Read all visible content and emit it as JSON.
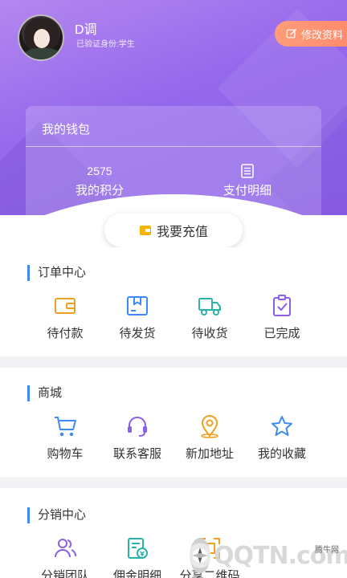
{
  "profile": {
    "name": "D调",
    "verify_text": "已验证身份:学生",
    "edit_label": "修改资料"
  },
  "wallet": {
    "title": "我的钱包",
    "points_value": "2575",
    "points_label": "我的积分",
    "payment_label": "支付明细"
  },
  "recharge_label": "我要充值",
  "orders": {
    "title": "订单中心",
    "items": [
      {
        "label": "待付款",
        "icon": "wallet-icon"
      },
      {
        "label": "待发货",
        "icon": "package-icon"
      },
      {
        "label": "待收货",
        "icon": "truck-icon"
      },
      {
        "label": "已完成",
        "icon": "clipboard-check-icon"
      }
    ]
  },
  "mall": {
    "title": "商城",
    "items": [
      {
        "label": "购物车",
        "icon": "cart-icon"
      },
      {
        "label": "联系客服",
        "icon": "headset-icon"
      },
      {
        "label": "新加地址",
        "icon": "location-icon"
      },
      {
        "label": "我的收藏",
        "icon": "star-icon"
      }
    ]
  },
  "distribution": {
    "title": "分销中心",
    "items": [
      {
        "label": "分销团队",
        "icon": "team-icon"
      },
      {
        "label": "佣金明细",
        "icon": "commission-icon"
      },
      {
        "label": "分享二维码",
        "icon": "qrcode-icon"
      }
    ]
  },
  "watermark": {
    "text": "QQTN.com",
    "small": "腾牛网"
  },
  "colors": {
    "header_gradient_start": "#b487f0",
    "header_gradient_end": "#8a5fe6",
    "section_accent": "#3d8bf2",
    "orange_icon": "#f0a020",
    "blue_icon": "#3d8bf2",
    "teal_icon": "#27b3a8",
    "purple_icon": "#8a5fe6",
    "edit_button": "#ff8a6c"
  }
}
